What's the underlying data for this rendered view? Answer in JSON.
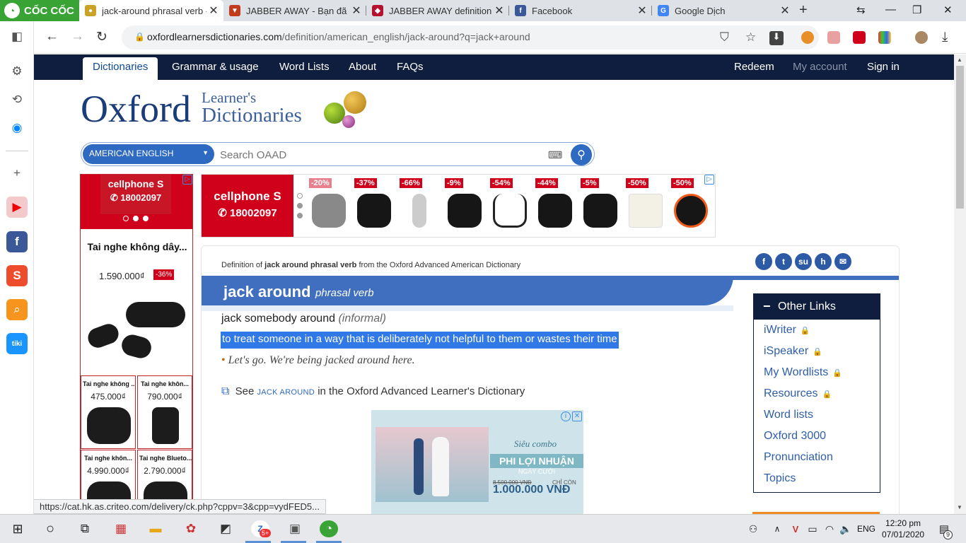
{
  "browser": {
    "brand": "CỐC CỐC",
    "tabs": [
      {
        "title": "jack-around phrasal verb - D",
        "active": true
      },
      {
        "title": "JABBER AWAY - Bạn đã đánh",
        "active": false
      },
      {
        "title": "JABBER AWAY definition fro",
        "active": false
      },
      {
        "title": "Facebook",
        "active": false
      },
      {
        "title": "Google Dịch",
        "active": false
      }
    ],
    "url_domain": "oxfordlearnersdictionaries.com",
    "url_path": "/definition/american_english/jack-around?q=jack+around"
  },
  "site_nav": {
    "items": [
      "Dictionaries",
      "Grammar & usage",
      "Word Lists",
      "About",
      "FAQs"
    ],
    "right": [
      "Redeem",
      "My account",
      "Sign in"
    ]
  },
  "logo": {
    "oxford": "Oxford",
    "learners": "Learner's",
    "dictionaries": "Dictionaries"
  },
  "search": {
    "language": "AMERICAN ENGLISH",
    "placeholder": "Search OAAD"
  },
  "left_ad": {
    "brand": "cellphone S",
    "phone": "18002097",
    "title": "Tai nghe không dây...",
    "price": "1.590.000₫",
    "discount": "-36%",
    "items": [
      {
        "name": "Tai nghe không ...",
        "price": "475.000₫"
      },
      {
        "name": "Tai nghe khôn...",
        "price": "790.000₫"
      },
      {
        "name": "Tai nghe khôn...",
        "price": "4.990.000₫"
      },
      {
        "name": "Tai nghe Blueto...",
        "price": "2.790.000₫"
      }
    ]
  },
  "banner_ad": {
    "brand": "cellphone S",
    "phone": "18002097",
    "discounts": [
      "-20%",
      "-37%",
      "-66%",
      "-9%",
      "-54%",
      "-44%",
      "-5%",
      "-50%",
      "-50%"
    ]
  },
  "entry": {
    "crumb_prefix": "Definition of",
    "crumb_bold": "jack around phrasal verb",
    "crumb_suffix": "from the Oxford Advanced American Dictionary",
    "headword": "jack around",
    "pos": "phrasal verb",
    "idiom": "jack somebody around",
    "register": "(informal)",
    "definition": "to treat someone in a way that is deliberately not helpful to them or wastes their time",
    "example": "Let's go. We're being jacked around here.",
    "see_prefix": "See",
    "see_link": "JACK AROUND",
    "see_suffix": "in the Oxford Advanced Learner's Dictionary"
  },
  "photo_ad": {
    "line1": "Siêu combo",
    "line2": "PHI LỢI NHUẬN",
    "line3": "NGÀY CƯỚI",
    "old_price": "8.500.000 VNĐ",
    "label": "CHỈ CÒN",
    "price": "1.000.000 VNĐ"
  },
  "other_links": {
    "title": "Other Links",
    "items": [
      {
        "label": "iWriter",
        "locked": true
      },
      {
        "label": "iSpeaker",
        "locked": true
      },
      {
        "label": "My Wordlists",
        "locked": true
      },
      {
        "label": "Resources",
        "locked": true
      },
      {
        "label": "Word lists",
        "locked": false
      },
      {
        "label": "Oxford 3000",
        "locked": false
      },
      {
        "label": "Pronunciation",
        "locked": false
      },
      {
        "label": "Topics",
        "locked": false
      }
    ]
  },
  "status_url": "https://cat.hk.as.criteo.com/delivery/ck.php?cppv=3&cpp=vydFED5...",
  "taskbar": {
    "language": "ENG",
    "time": "12:20 pm",
    "date": "07/01/2020",
    "notifications": "9",
    "zalo_badge": "5+"
  }
}
